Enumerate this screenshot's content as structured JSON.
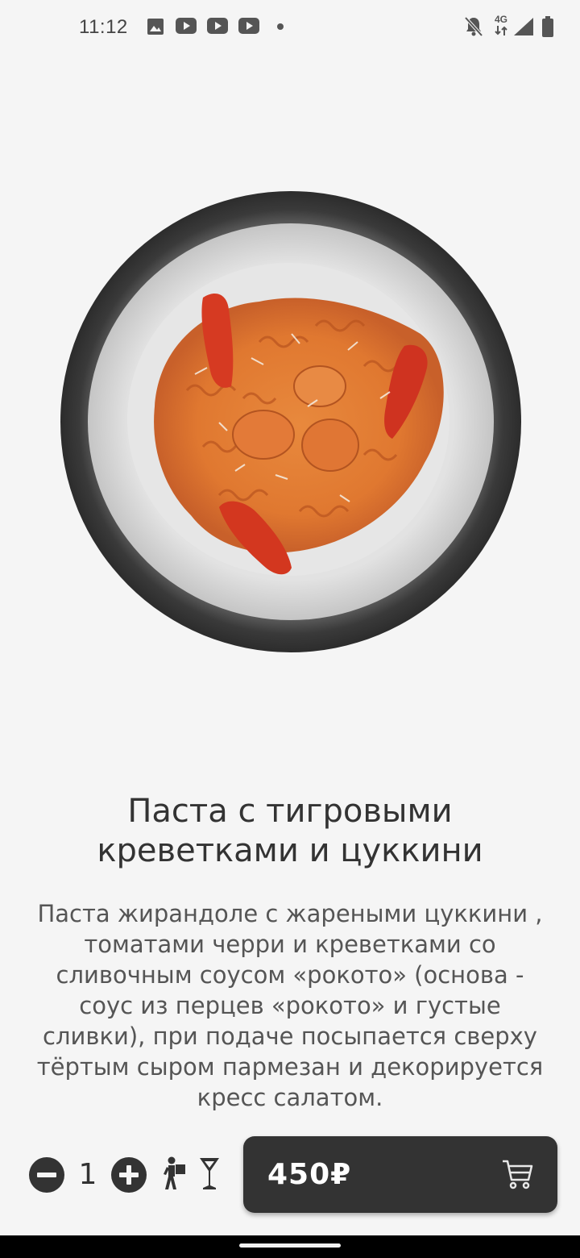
{
  "status_bar": {
    "time": "11:12",
    "network": "4G",
    "icons": [
      "image-icon",
      "youtube-icon",
      "youtube-icon",
      "youtube-icon",
      "dot-icon",
      "bell-off-icon",
      "signal-icon",
      "battery-icon"
    ]
  },
  "product": {
    "title": "Паста с тигровыми креветками и цуккини",
    "description": "Паста жирандоле с жареными цуккини , томатами черри и креветками со сливочным соусом «рокото» (основа - соус из перцев «рокото» и густые сливки), при подаче посыпается сверху тёртым сыром пармезан и декорируется кресс салатом.",
    "quantity": "1",
    "price": "450₽"
  },
  "colors": {
    "background": "#f5f5f5",
    "dark": "#333333",
    "accent_text": "#ffffff"
  }
}
